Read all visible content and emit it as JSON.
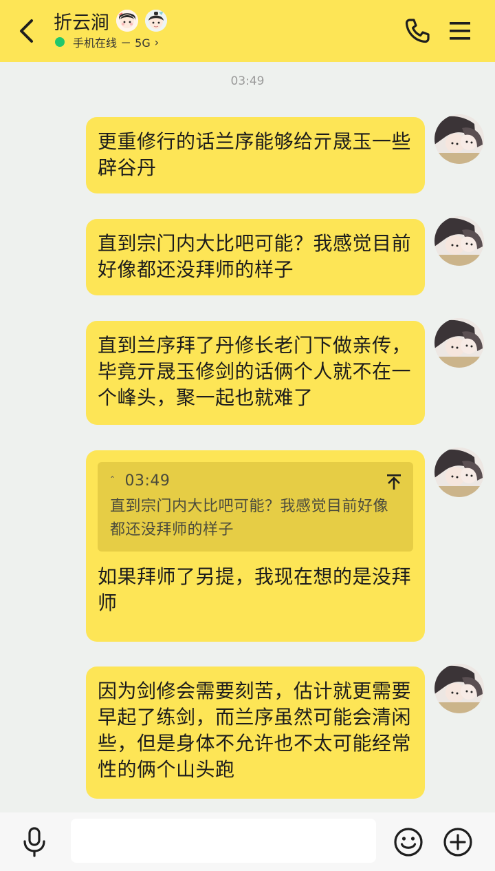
{
  "header": {
    "title": "折云涧",
    "status_text": "手机在线 － 5G",
    "status_chevron": "›",
    "icons": [
      "back-arrow-icon",
      "avatar-girl-icon",
      "avatar-boy-icon",
      "phone-icon",
      "menu-icon"
    ]
  },
  "chat": {
    "timestamp": "03:49",
    "messages": [
      {
        "text": "更重修行的话兰序能够给亓晟玉一些辟谷丹"
      },
      {
        "text": "直到宗门内大比吧可能？我感觉目前好像都还没拜师的样子"
      },
      {
        "text": "直到兰序拜了丹修长老门下做亲传，毕竟亓晟玉修剑的话俩个人就不在一个峰头，聚一起也就难了"
      },
      {
        "quote": {
          "caret": "ˆ",
          "time": "03:49",
          "text": "直到宗门内大比吧可能？我感觉目前好像都还没拜师的样子"
        },
        "text": "如果拜师了另提，我现在想的是没拜师"
      },
      {
        "text": "因为剑修会需要刻苦，估计就更需要早起了练剑，而兰序虽然可能会清闲些，但是身体不允许也不太可能经常性的俩个山头跑"
      }
    ]
  },
  "input_bar": {
    "placeholder": "",
    "icons": [
      "microphone-icon",
      "emoji-icon",
      "plus-icon"
    ]
  },
  "colors": {
    "header_bg": "#fde556",
    "bubble_bg": "#fde556",
    "quote_bg": "#e6cd45",
    "chat_bg": "#eef1ee",
    "online_dot": "#21c76b"
  }
}
